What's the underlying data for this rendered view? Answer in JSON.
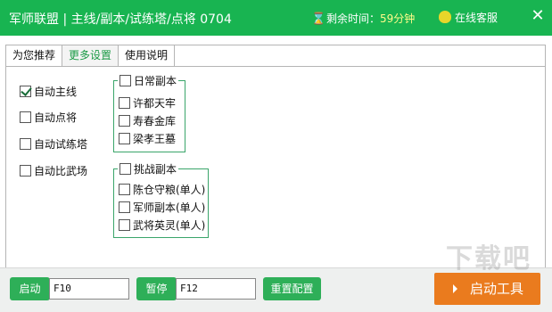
{
  "titlebar": {
    "title": "军师联盟 | 主线/副本/试练塔/点将 0704",
    "time_label": "剩余时间：",
    "time_value": "59分钟",
    "service": "在线客服",
    "close": "✕"
  },
  "tabs": [
    "为您推荐",
    "更多设置",
    "使用说明"
  ],
  "active_tab": "更多设置",
  "options": [
    {
      "label": "自动主线",
      "checked": true
    },
    {
      "label": "自动点将",
      "checked": false
    },
    {
      "label": "自动试练塔",
      "checked": false
    },
    {
      "label": "自动比武场",
      "checked": false
    }
  ],
  "daily_group": {
    "title": "日常副本",
    "items": [
      "许都天牢",
      "寿春金库",
      "梁孝王墓"
    ]
  },
  "challenge_group": {
    "title": "挑战副本",
    "items": [
      "陈仓守粮(单人)",
      "军师副本(单人)",
      "武将英灵(单人)"
    ]
  },
  "bottom": {
    "start_label": "启动",
    "start_key": "F10",
    "pause_label": "暂停",
    "pause_key": "F12",
    "reset_label": "重置配置",
    "start_tool_label": "启动工具"
  },
  "watermark": "下载吧"
}
